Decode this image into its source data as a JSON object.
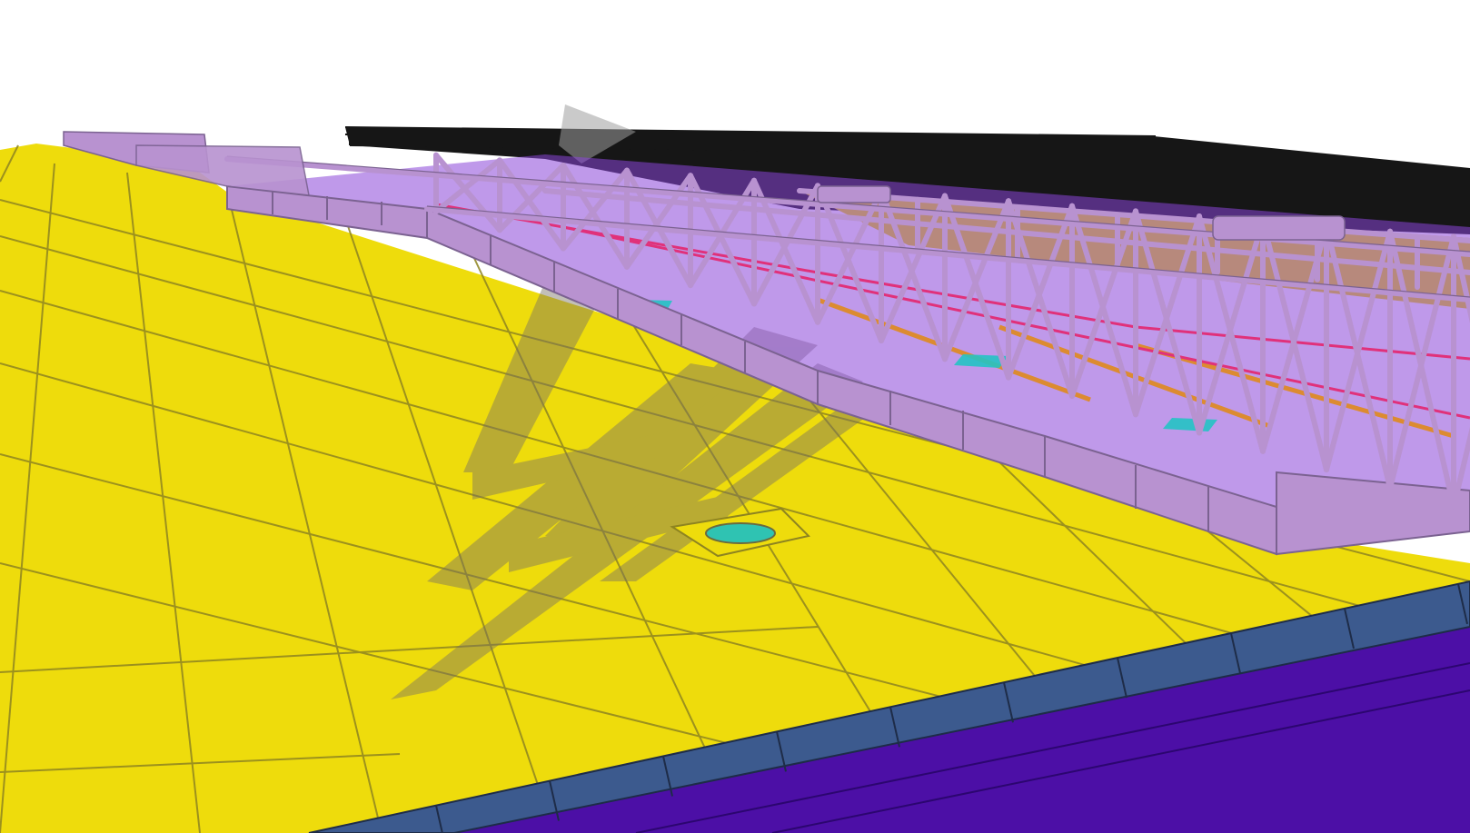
{
  "viewer": {
    "view_mode": "3d-perspective",
    "background_color": "#ffffff"
  },
  "model": {
    "elements": [
      {
        "name": "roof-deck",
        "color": "#eedc0c",
        "edge_color": "#8e8420"
      },
      {
        "name": "steel-truss-gantry",
        "color": "#b892d0",
        "edge_color": "#7b6291"
      },
      {
        "name": "interior-framing",
        "color": "#8a45d8"
      },
      {
        "name": "interior-beams-orange",
        "color": "#e08a1e"
      },
      {
        "name": "interior-floor-cyan",
        "color": "#23c3c4"
      },
      {
        "name": "handrail",
        "color": "#e0317a"
      },
      {
        "name": "parapet-cap",
        "color": "#3c5a8e"
      },
      {
        "name": "fascia",
        "color": "#4c0fa6"
      },
      {
        "name": "far-structure",
        "color": "#161616"
      },
      {
        "name": "cast-shadow",
        "color": "#7a7264"
      },
      {
        "name": "roof-drain",
        "color": "#2fc3b2"
      }
    ]
  }
}
